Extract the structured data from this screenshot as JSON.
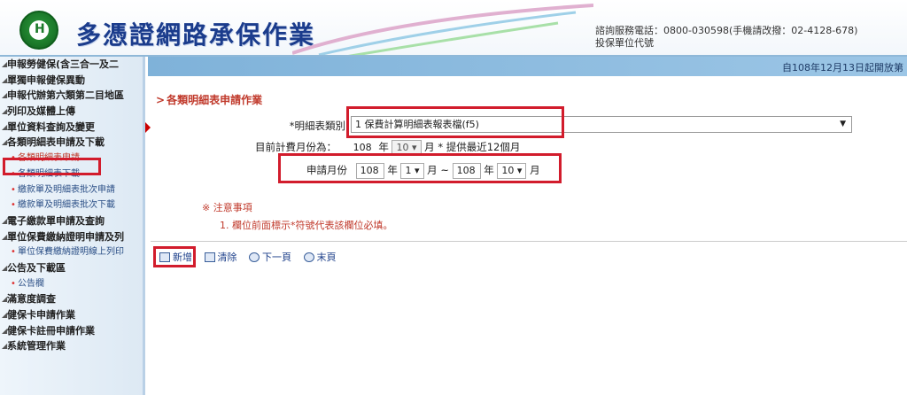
{
  "header": {
    "title": "多憑證網路承保作業",
    "contact_line1": "諮詢服務電話：0800-030598(手機請改撥：02-4128-678)",
    "contact_line2": "投保單位代號"
  },
  "topbar": {
    "date_text": "自108年12月13日起開放第"
  },
  "sidebar": {
    "items": [
      {
        "label": "申報勞健保(含三合一及二",
        "type": "main"
      },
      {
        "label": "單獨申報健保異動",
        "type": "main"
      },
      {
        "label": "申報代辦第六類第二目地區",
        "type": "main"
      },
      {
        "label": "列印及媒體上傳",
        "type": "main"
      },
      {
        "label": "單位資料查詢及變更",
        "type": "main"
      },
      {
        "label": "各類明細表申請及下載",
        "type": "main"
      },
      {
        "label": "各類明細表申請",
        "type": "sub",
        "active": true
      },
      {
        "label": "各類明細表下載",
        "type": "sub"
      },
      {
        "label": "繳款單及明細表批次申請",
        "type": "sub"
      },
      {
        "label": "繳款單及明細表批次下載",
        "type": "sub"
      },
      {
        "label": "電子繳款單申請及查詢",
        "type": "main"
      },
      {
        "label": "單位保費繳納證明申請及列",
        "type": "main"
      },
      {
        "label": "單位保費繳納證明線上列印",
        "type": "sub"
      },
      {
        "label": "公告及下載區",
        "type": "main"
      },
      {
        "label": "公告欄",
        "type": "sub"
      },
      {
        "label": "滿意度調查",
        "type": "main"
      },
      {
        "label": "健保卡申請作業",
        "type": "main"
      },
      {
        "label": "健保卡註冊申請作業",
        "type": "main"
      },
      {
        "label": "系統管理作業",
        "type": "main"
      }
    ]
  },
  "main": {
    "section_title": "各類明細表申請作業",
    "detail_type_label": "*明細表類別",
    "detail_type_value": "1 保費計算明細表報表檔(f5)",
    "current_month_label": "目前計費月份為：",
    "current_year": "108",
    "year_unit": "年",
    "current_month": "10",
    "month_unit": "月",
    "current_note": "* 提供最近12個月",
    "apply_month_label": "申請月份",
    "from_year": "108",
    "from_month": "1",
    "tilde": "~",
    "to_year": "108",
    "to_month": "10",
    "note_title": "※ 注意事項",
    "note_line1": "1. 欄位前面標示*符號代表該欄位必填。",
    "toolbar": {
      "add": "新增",
      "clear": "清除",
      "next": "下一頁",
      "last": "末頁"
    }
  },
  "colors": {
    "highlight": "#d21c2c",
    "title_blue": "#1b3c8c",
    "sidebar_bg": "#e6f0f8"
  }
}
